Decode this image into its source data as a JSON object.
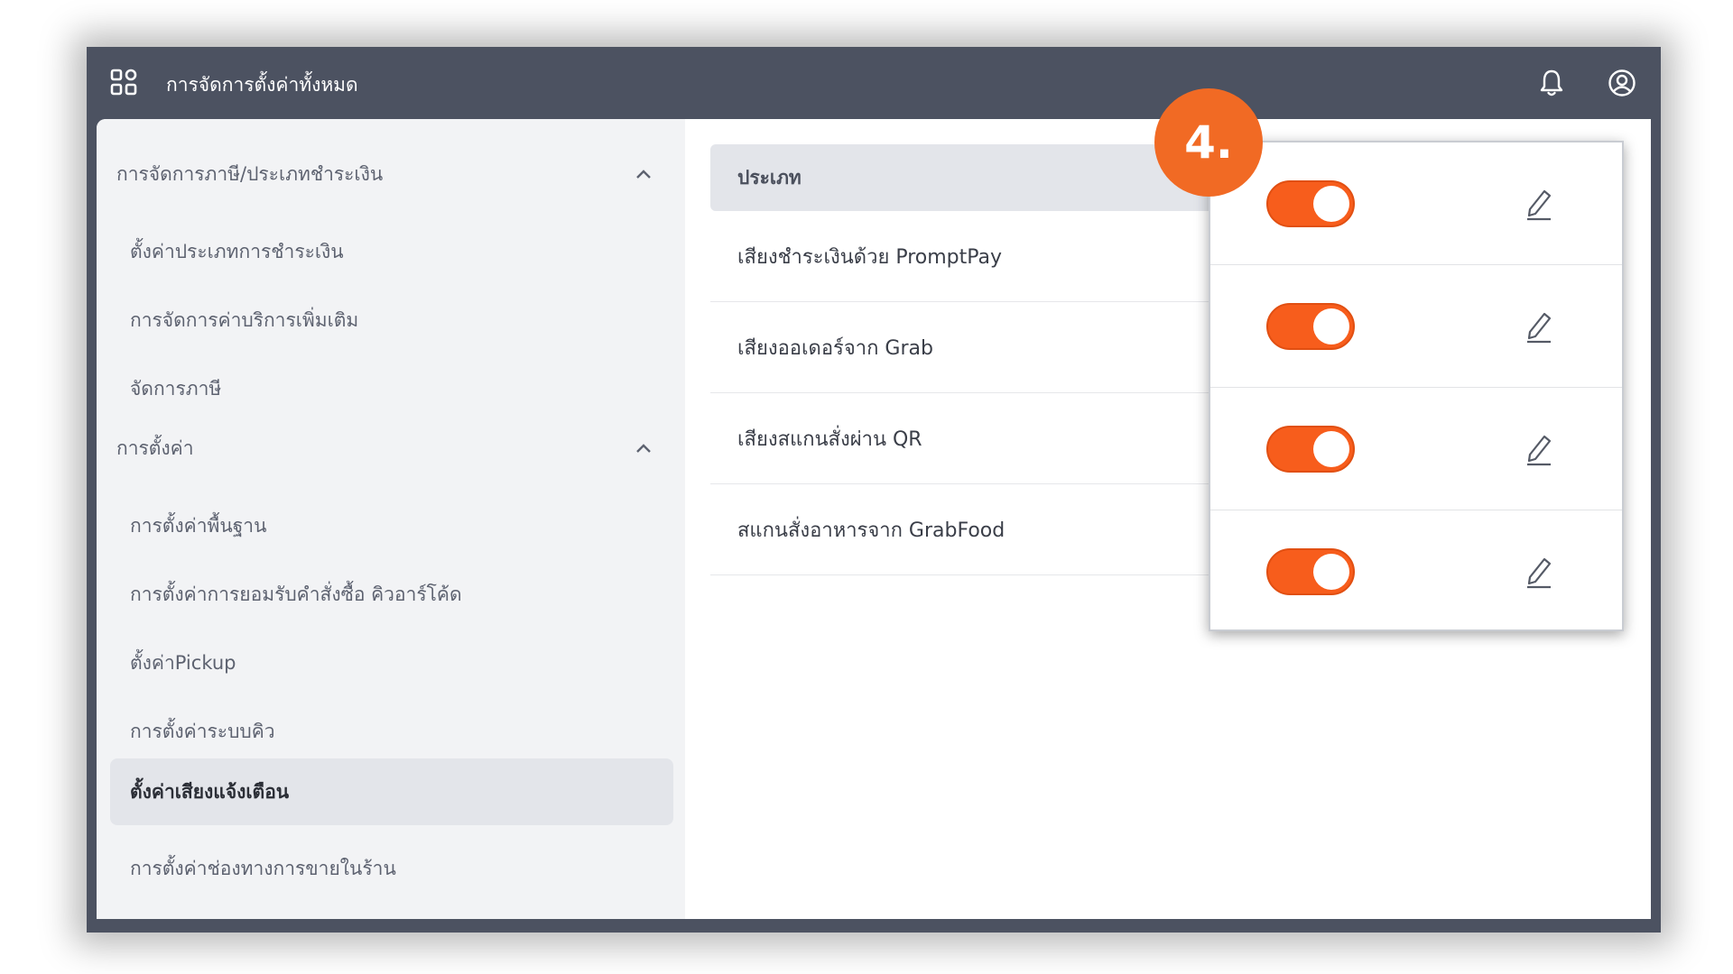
{
  "topbar": {
    "title": "การจัดการตั้งค่าทั้งหมด",
    "icons": [
      "grid-icon",
      "bell-icon",
      "user-circle-icon"
    ]
  },
  "sidebar": {
    "groups": [
      {
        "label": "การจัดการภาษี/ประเภทชำระเงิน",
        "expanded": true,
        "items": [
          {
            "label": "ตั้งค่าประเภทการชำระเงิน"
          },
          {
            "label": "การจัดการค่าบริการเพิ่มเติม"
          },
          {
            "label": "จัดการภาษี"
          }
        ]
      },
      {
        "label": "การตั้งค่า",
        "expanded": true,
        "items": [
          {
            "label": "การตั้งค่าพื้นฐาน"
          },
          {
            "label": "การตั้งค่าการยอมรับคำสั่งซื้อ คิวอาร์โค้ด"
          },
          {
            "label": "ตั้งค่าPickup"
          },
          {
            "label": "การตั้งค่าระบบคิว"
          },
          {
            "label": "ตั้งค่าเสียงแจ้งเตือน",
            "active": true
          },
          {
            "label": "การตั้งค่าช่องทางการขายในร้าน"
          }
        ]
      }
    ]
  },
  "table": {
    "header": "ประเภท",
    "rows": [
      {
        "label": "เสียงชำระเงินด้วย PromptPay",
        "enabled": true
      },
      {
        "label": "เสียงออเดอร์จาก Grab",
        "enabled": true
      },
      {
        "label": "เสียงสแกนสั่งผ่าน QR",
        "enabled": true
      },
      {
        "label": "สแกนสั่งอาหารจาก GrabFood",
        "enabled": true
      }
    ]
  },
  "step_badge": "4.",
  "colors": {
    "topbar": "#4c5261",
    "toggle_on": "#f75d1c",
    "badge": "#f16a24",
    "sidebar_bg": "#f2f3f5",
    "active_item_bg": "#e3e5ea"
  }
}
